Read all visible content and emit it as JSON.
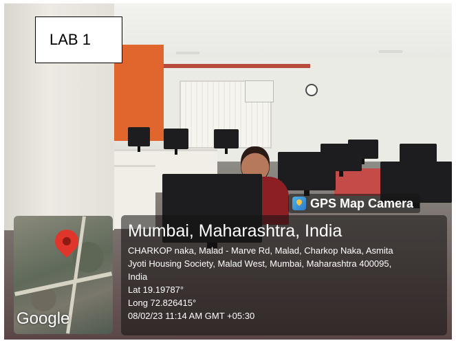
{
  "label": {
    "text": "LAB 1"
  },
  "gps_overlay": {
    "app_name": "GPS Map Camera",
    "city": "Mumbai, Maharashtra, India",
    "address_line1": "CHARKOP naka, Malad - Marve Rd, Malad, Charkop Naka, Asmita",
    "address_line2": "Jyoti Housing Society, Malad West, Mumbai, Maharashtra 400095,",
    "address_line3": "India",
    "latitude": "Lat 19.19787°",
    "longitude": "Long 72.826415°",
    "datetime": "08/02/23 11:14 AM GMT +05:30",
    "map_brand": "Google",
    "icons": {
      "app": "gps-map-camera-icon",
      "pin": "map-pin-icon"
    },
    "colors": {
      "pin": "#e0352b",
      "panel": "#141212"
    }
  },
  "scene": {
    "colors": {
      "accent_wall": "#e0662e",
      "desk_surface": "#c44b47"
    }
  }
}
